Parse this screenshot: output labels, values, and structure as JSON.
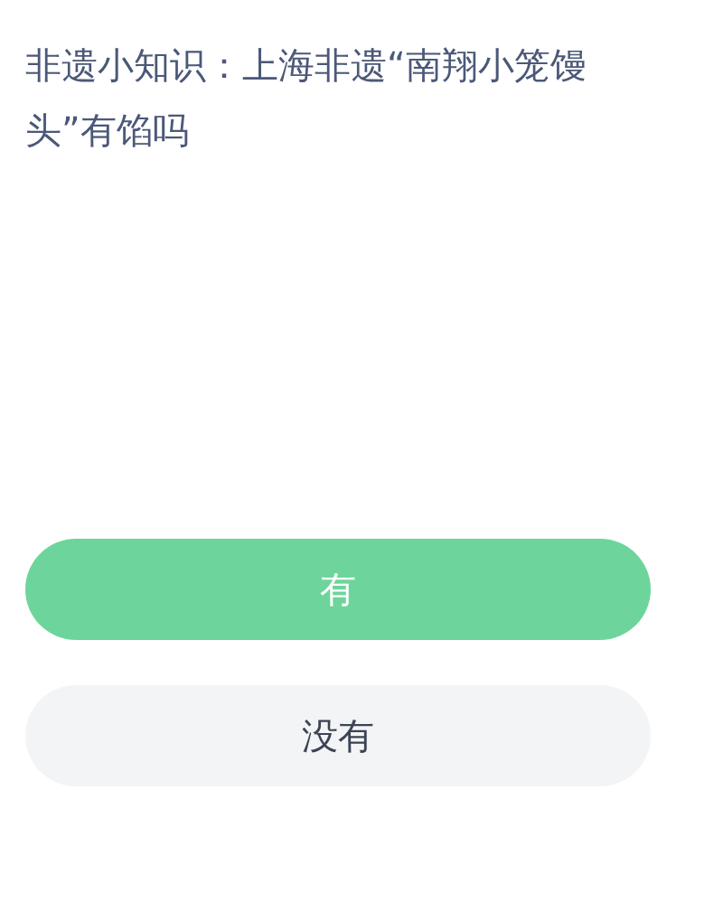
{
  "question": "非遗小知识：上海非遗“南翔小笼馒头”有馅吗",
  "options": [
    {
      "label": "有",
      "kind": "highlighted"
    },
    {
      "label": "没有",
      "kind": "plain"
    }
  ]
}
